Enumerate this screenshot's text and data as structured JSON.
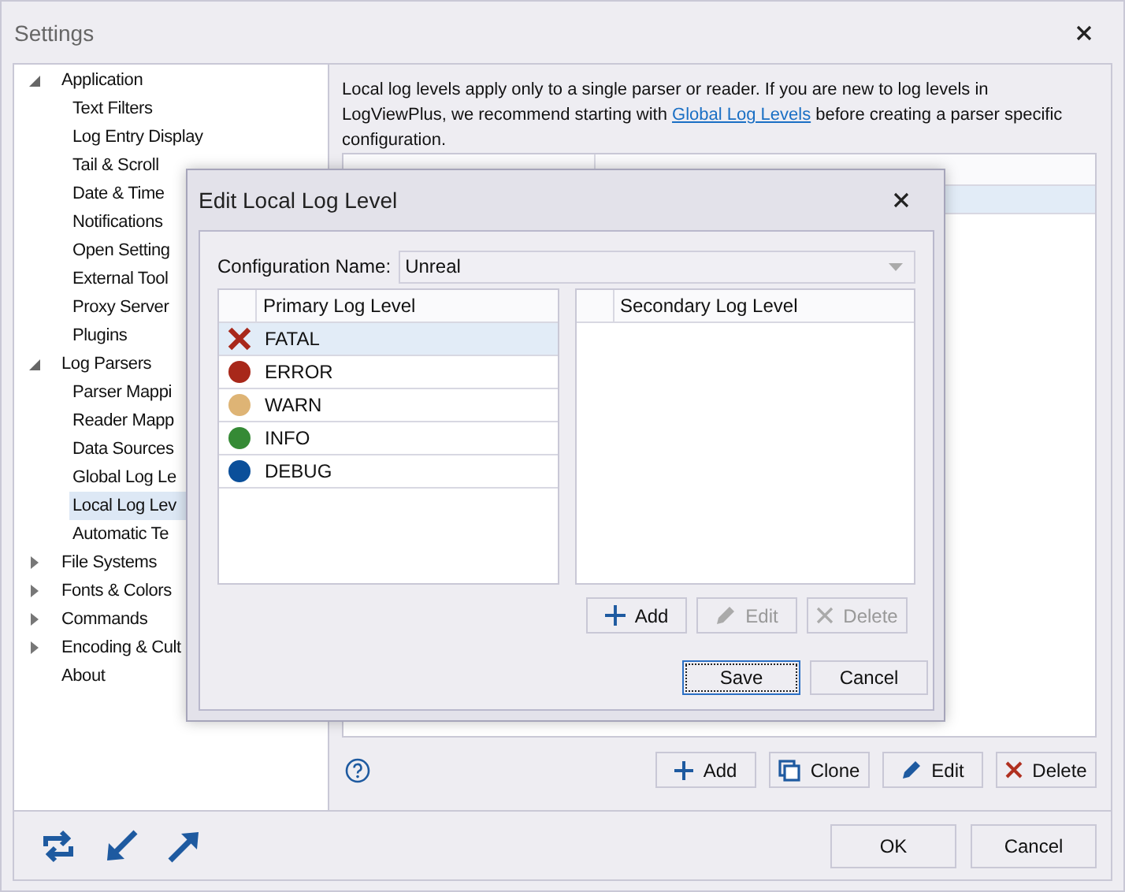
{
  "window": {
    "title": "Settings"
  },
  "tree": [
    {
      "label": "Application",
      "expandable": true,
      "expanded": true,
      "selected": false,
      "children": [
        {
          "label": "Text Filters",
          "selected": false
        },
        {
          "label": "Log Entry Display",
          "selected": false
        },
        {
          "label": "Tail & Scroll",
          "selected": false
        },
        {
          "label": "Date & Time",
          "selected": false
        },
        {
          "label": "Notifications",
          "selected": false
        },
        {
          "label": "Open Setting",
          "selected": false
        },
        {
          "label": "External Tool",
          "selected": false
        },
        {
          "label": "Proxy Server",
          "selected": false
        },
        {
          "label": "Plugins",
          "selected": false
        }
      ]
    },
    {
      "label": "Log Parsers",
      "expandable": true,
      "expanded": true,
      "selected": false,
      "children": [
        {
          "label": "Parser Mappi",
          "selected": false
        },
        {
          "label": "Reader Mapp",
          "selected": false
        },
        {
          "label": "Data Sources",
          "selected": false
        },
        {
          "label": "Global Log Le",
          "selected": false
        },
        {
          "label": "Local Log Lev",
          "selected": true
        },
        {
          "label": "Automatic Te",
          "selected": false
        }
      ]
    },
    {
      "label": "File Systems",
      "expandable": true,
      "expanded": false,
      "selected": false
    },
    {
      "label": "Fonts & Colors",
      "expandable": true,
      "expanded": false,
      "selected": false
    },
    {
      "label": "Commands",
      "expandable": true,
      "expanded": false,
      "selected": false
    },
    {
      "label": "Encoding & Cult",
      "expandable": true,
      "expanded": false,
      "selected": false
    },
    {
      "label": "About",
      "expandable": false,
      "expanded": false,
      "selected": false
    }
  ],
  "description": {
    "before": "Local log levels apply only to a single parser or reader.  If you are new to log levels in LogViewPlus, we recommend starting with ",
    "link": "Global Log Levels",
    "after": " before creating a parser specific configuration."
  },
  "panel_buttons": [
    {
      "label": "Add",
      "kind": "add",
      "disabled": false
    },
    {
      "label": "Clone",
      "kind": "clone",
      "disabled": false
    },
    {
      "label": "Edit",
      "kind": "edit",
      "disabled": false
    },
    {
      "label": "Delete",
      "kind": "delete",
      "disabled": false
    }
  ],
  "footer_buttons": [
    {
      "label": "OK"
    },
    {
      "label": "Cancel"
    }
  ],
  "dialog": {
    "title": "Edit Local Log Level",
    "config_label": "Configuration Name:",
    "config_value": "Unreal",
    "primary": {
      "header": "Primary Log Level",
      "rows": [
        {
          "label": "FATAL",
          "kind": "cross",
          "color": "#a8281a",
          "selected": true
        },
        {
          "label": "ERROR",
          "kind": "dot",
          "color": "#a8281a",
          "selected": false
        },
        {
          "label": "WARN",
          "kind": "dot",
          "color": "#deb475",
          "selected": false
        },
        {
          "label": "INFO",
          "kind": "dot",
          "color": "#358a35",
          "selected": false
        },
        {
          "label": "DEBUG",
          "kind": "dot",
          "color": "#0b4f9a",
          "selected": false
        }
      ]
    },
    "secondary": {
      "header": "Secondary Log Level"
    },
    "list_buttons": [
      {
        "label": "Add",
        "kind": "add",
        "disabled": false
      },
      {
        "label": "Edit",
        "kind": "edit",
        "disabled": true
      },
      {
        "label": "Delete",
        "kind": "delete",
        "disabled": true
      }
    ],
    "buttons": [
      {
        "label": "Save",
        "default": true
      },
      {
        "label": "Cancel",
        "default": false
      }
    ]
  }
}
